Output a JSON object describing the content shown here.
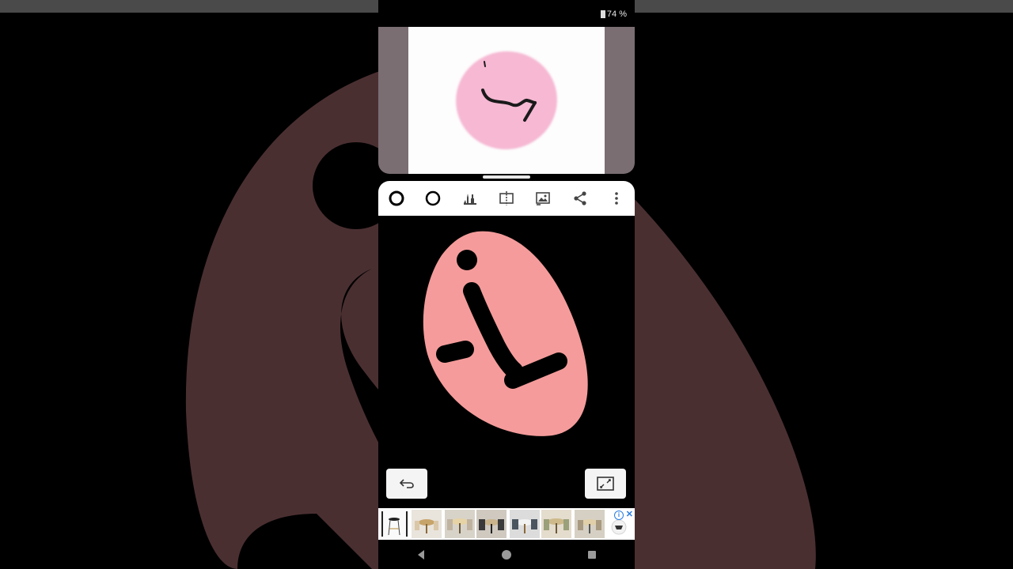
{
  "status_bar": {
    "battery_text": "74 %"
  },
  "toolbar": {
    "tools": [
      {
        "icon": "brush-size-ring-icon"
      },
      {
        "icon": "brush-outline-ring-icon"
      },
      {
        "icon": "paint-tools-icon"
      },
      {
        "icon": "mirror-split-icon"
      },
      {
        "icon": "insert-image-icon"
      },
      {
        "icon": "share-icon"
      },
      {
        "icon": "more-vertical-icon"
      }
    ]
  },
  "canvas_actions": {
    "undo_icon": "undo-icon",
    "fullscreen_icon": "fullscreen-icon"
  },
  "ad_banner": {
    "info_label": "i",
    "close_label": "✕"
  },
  "colors": {
    "page_background": "#000000",
    "background_drawing": "#4a2f31",
    "canvas_blob": "#f59b9b",
    "reference_blob": "#f6b8d3",
    "stroke": "#000000",
    "toolbar_bg": "#ffffff"
  }
}
